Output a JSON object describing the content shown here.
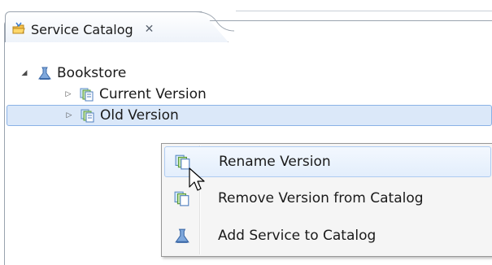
{
  "view": {
    "tab_title": "Service Catalog",
    "tab_close_glyph": "✕",
    "tab_icon": "catalog-icon"
  },
  "tree": {
    "items": [
      {
        "label": "Bookstore",
        "expanded": true,
        "icon": "service-icon"
      },
      {
        "label": "Current Version",
        "expanded": false,
        "icon": "version-icon"
      },
      {
        "label": "Old Version",
        "expanded": false,
        "icon": "version-icon",
        "selected": true
      }
    ]
  },
  "context_menu": {
    "items": [
      {
        "label": "Rename Version",
        "icon": "version-icon",
        "hovered": true
      },
      {
        "label": "Remove Version from Catalog",
        "icon": "version-icon"
      },
      {
        "label": "Add Service to Catalog",
        "icon": "service-icon"
      }
    ]
  },
  "colors": {
    "selection_bg": "#dbe8f9",
    "selection_border": "#8ab2e6",
    "menu_bg": "#f5f5f5"
  }
}
